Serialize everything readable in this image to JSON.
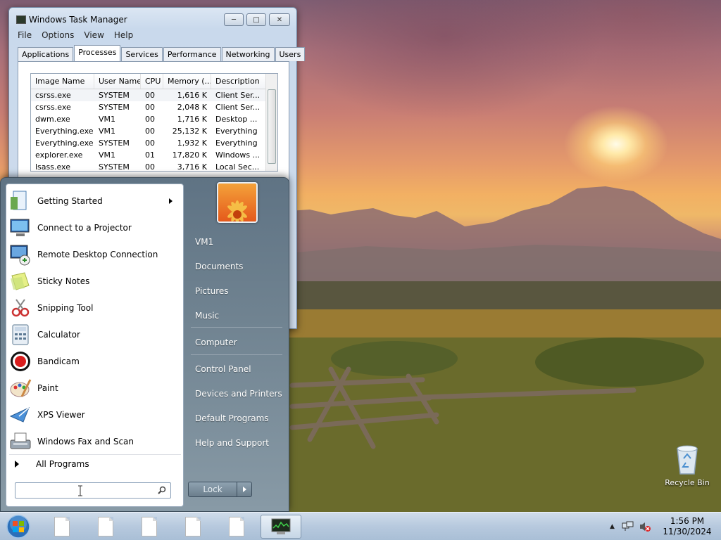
{
  "task_manager": {
    "title": "Windows Task Manager",
    "menu": [
      "File",
      "Options",
      "View",
      "Help"
    ],
    "tabs": [
      "Applications",
      "Processes",
      "Services",
      "Performance",
      "Networking",
      "Users"
    ],
    "active_tab": "Processes",
    "columns": [
      "Image Name",
      "User Name",
      "CPU",
      "Memory (...",
      "Description"
    ],
    "processes": [
      {
        "name": "csrss.exe",
        "user": "SYSTEM",
        "cpu": "00",
        "mem": "1,616 K",
        "desc": "Client Ser..."
      },
      {
        "name": "csrss.exe",
        "user": "SYSTEM",
        "cpu": "00",
        "mem": "2,048 K",
        "desc": "Client Ser..."
      },
      {
        "name": "dwm.exe",
        "user": "VM1",
        "cpu": "00",
        "mem": "1,716 K",
        "desc": "Desktop ..."
      },
      {
        "name": "Everything.exe",
        "user": "VM1",
        "cpu": "00",
        "mem": "25,132 K",
        "desc": "Everything"
      },
      {
        "name": "Everything.exe",
        "user": "SYSTEM",
        "cpu": "00",
        "mem": "1,932 K",
        "desc": "Everything"
      },
      {
        "name": "explorer.exe",
        "user": "VM1",
        "cpu": "01",
        "mem": "17,820 K",
        "desc": "Windows ..."
      },
      {
        "name": "lsass.exe",
        "user": "SYSTEM",
        "cpu": "00",
        "mem": "3,716 K",
        "desc": "Local Sec..."
      }
    ]
  },
  "start_menu": {
    "programs": [
      {
        "label": "Getting Started",
        "icon": "getting-started-icon",
        "submenu": true
      },
      {
        "label": "Connect to a Projector",
        "icon": "projector-icon",
        "submenu": false
      },
      {
        "label": "Remote Desktop Connection",
        "icon": "remote-desktop-icon",
        "submenu": false
      },
      {
        "label": "Sticky Notes",
        "icon": "sticky-notes-icon",
        "submenu": false
      },
      {
        "label": "Snipping Tool",
        "icon": "snipping-tool-icon",
        "submenu": false
      },
      {
        "label": "Calculator",
        "icon": "calculator-icon",
        "submenu": false
      },
      {
        "label": "Bandicam",
        "icon": "bandicam-icon",
        "submenu": false
      },
      {
        "label": "Paint",
        "icon": "paint-icon",
        "submenu": false
      },
      {
        "label": "XPS Viewer",
        "icon": "xps-viewer-icon",
        "submenu": false
      },
      {
        "label": "Windows Fax and Scan",
        "icon": "fax-scan-icon",
        "submenu": false
      }
    ],
    "all_programs": "All Programs",
    "search_placeholder": "",
    "right_items": [
      "VM1",
      "Documents",
      "Pictures",
      "Music",
      "Computer",
      "Control Panel",
      "Devices and Printers",
      "Default Programs",
      "Help and Support"
    ],
    "lock_label": "Lock"
  },
  "desktop": {
    "recycle_bin": "Recycle Bin"
  },
  "taskbar": {
    "time": "1:56 PM",
    "date": "11/30/2024"
  },
  "colors": {
    "taskbar": "#b7c9de",
    "start_menu": "#6f8290",
    "selection": "#f2f4f7"
  }
}
